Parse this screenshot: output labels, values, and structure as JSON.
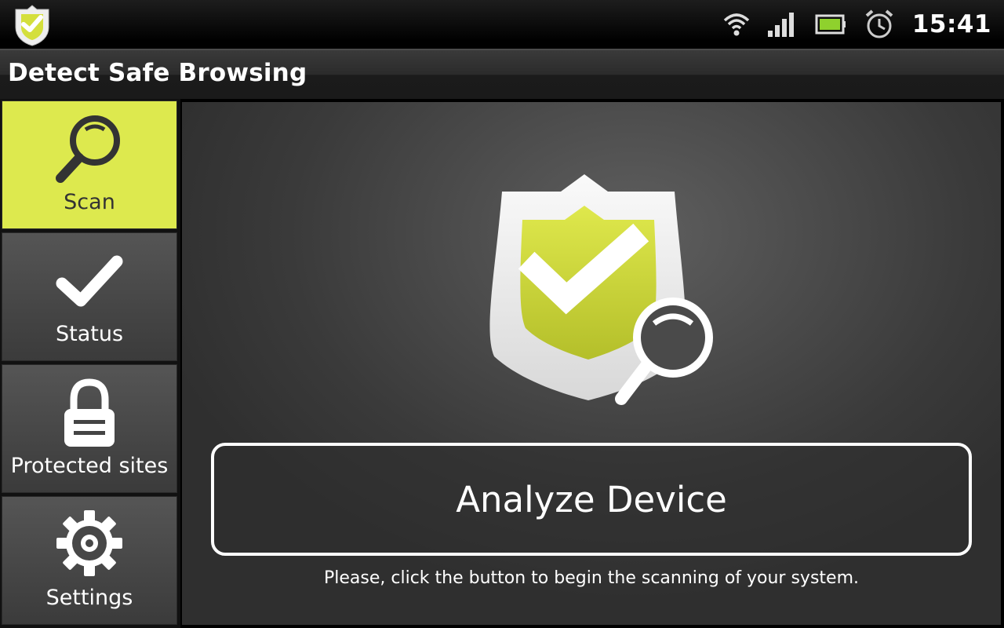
{
  "status_bar": {
    "time": "15:41",
    "icons": [
      "app-shield-icon",
      "wifi-icon",
      "signal-icon",
      "battery-icon",
      "alarm-icon"
    ]
  },
  "app": {
    "title": "Detect Safe Browsing"
  },
  "sidebar": {
    "items": [
      {
        "label": "Scan",
        "icon": "magnifier-icon",
        "active": true
      },
      {
        "label": "Status",
        "icon": "checkmark-icon",
        "active": false
      },
      {
        "label": "Protected sites",
        "icon": "padlock-icon",
        "active": false
      },
      {
        "label": "Settings",
        "icon": "gear-icon",
        "active": false
      }
    ]
  },
  "main": {
    "hero_icon": "shield-check-magnifier-icon",
    "button_label": "Analyze Device",
    "hint": "Please, click the button to begin the scanning of your system."
  },
  "colors": {
    "accent": "#dde94e",
    "panel": "#3f3f3f",
    "text": "#ffffff"
  }
}
